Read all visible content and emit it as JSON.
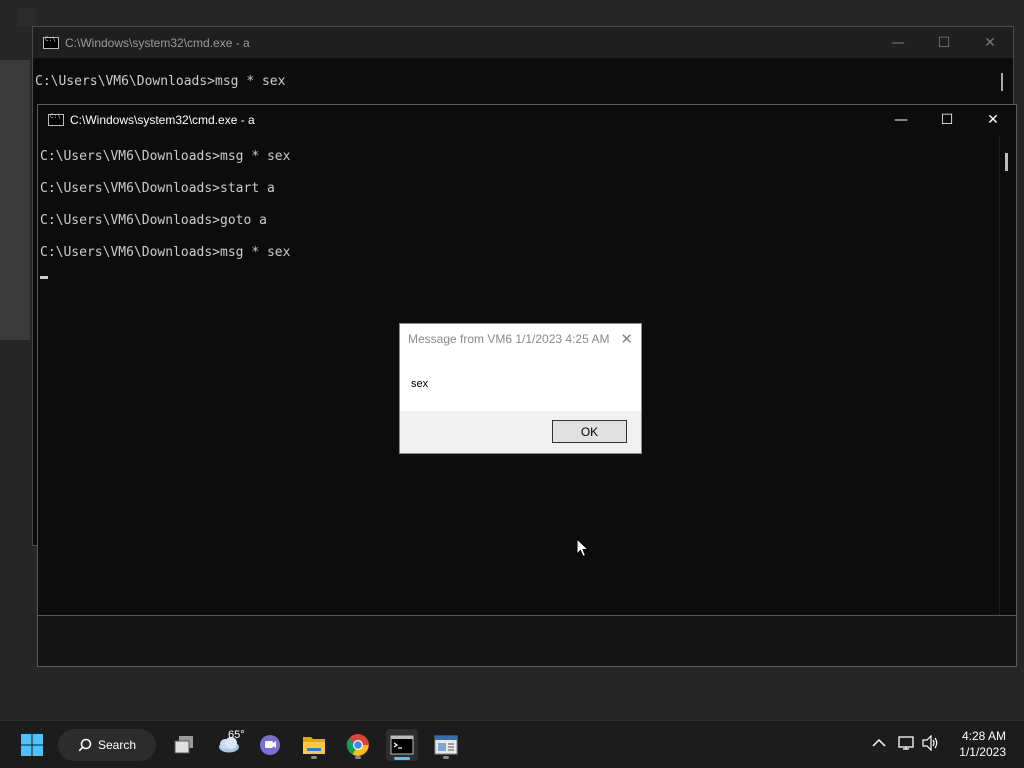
{
  "back_window": {
    "title": "C:\\Windows\\system32\\cmd.exe - a",
    "console_line": "C:\\Users\\VM6\\Downloads>msg * sex",
    "minimize": "—",
    "maximize": "☐",
    "close": "✕"
  },
  "front_window": {
    "title": "C:\\Windows\\system32\\cmd.exe - a",
    "lines": [
      "C:\\Users\\VM6\\Downloads>msg * sex",
      "C:\\Users\\VM6\\Downloads>start a",
      "C:\\Users\\VM6\\Downloads>goto a",
      "C:\\Users\\VM6\\Downloads>msg * sex"
    ],
    "minimize": "—",
    "maximize": "☐",
    "close": "✕"
  },
  "dialog": {
    "title": "Message from VM6 1/1/2023 4:25 AM",
    "close": "✕",
    "message": "sex",
    "ok_label": "OK"
  },
  "taskbar": {
    "search_label": "Search",
    "weather_temp": "65°",
    "clock_time": "4:28 AM",
    "clock_date": "1/1/2023",
    "icons": [
      "start-icon",
      "search-icon",
      "task-view-icon",
      "weather-icon",
      "teams-chat-icon",
      "file-explorer-icon",
      "chrome-icon",
      "terminal-icon",
      "app-icon"
    ],
    "tray_icons": [
      "chevron-up-icon",
      "network-icon",
      "volume-icon"
    ]
  },
  "colors": {
    "console_bg": "#0c0c0c",
    "console_text": "#cccccc",
    "taskbar_bg": "#1c1c1c",
    "accent": "#4cc2ff"
  }
}
